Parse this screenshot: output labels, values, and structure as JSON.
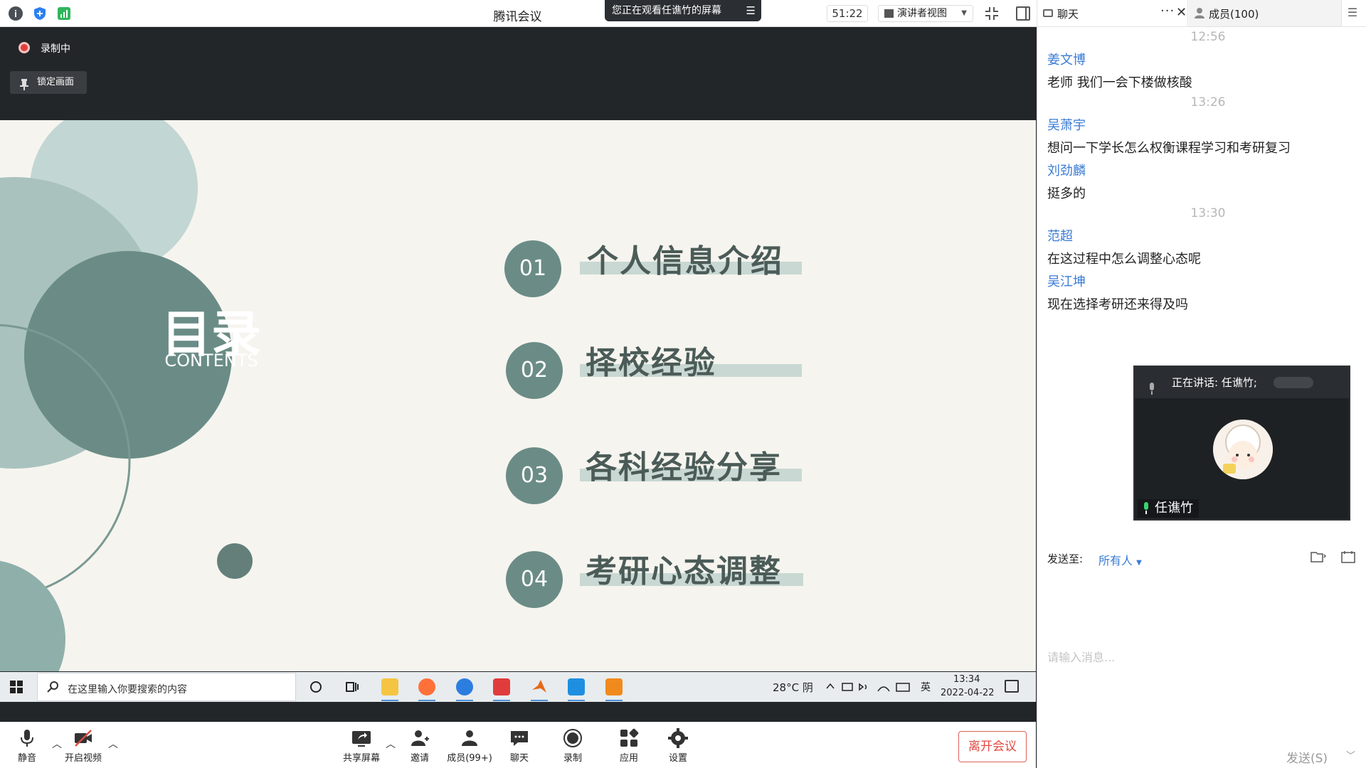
{
  "titlebar": {
    "app_title": "腾讯会议",
    "viewing_notice": "您正在观看任谯竹的屏幕",
    "timer": "51:22",
    "view_mode": "演讲者视图"
  },
  "tabs": {
    "chat": "聊天",
    "members": "成员(100)"
  },
  "stage": {
    "recording_label": "录制中",
    "lock_label": "锁定画面"
  },
  "slide": {
    "heading": "目录",
    "subheading": "CONTENTS",
    "items": [
      {
        "num": "01",
        "title": "个人信息介绍"
      },
      {
        "num": "02",
        "title": "择校经验"
      },
      {
        "num": "03",
        "title": "各科经验分享"
      },
      {
        "num": "04",
        "title": "考研心态调整"
      }
    ]
  },
  "taskbar": {
    "search_placeholder": "在这里输入你要搜索的内容",
    "weather": "28°C 阴",
    "lang": "英",
    "time": "13:34",
    "date": "2022-04-22"
  },
  "toolbar": {
    "mute": "静音",
    "video": "开启视频",
    "share": "共享屏幕",
    "invite": "邀请",
    "members": "成员(99+)",
    "chat": "聊天",
    "record": "录制",
    "apps": "应用",
    "settings": "设置",
    "leave": "离开会议"
  },
  "chat": {
    "messages": [
      {
        "type": "time",
        "text": "12:56"
      },
      {
        "type": "name",
        "text": "姜文博"
      },
      {
        "type": "msg",
        "text": "老师  我们一会下楼做核酸"
      },
      {
        "type": "time",
        "text": "13:26"
      },
      {
        "type": "name",
        "text": "吴萧宇"
      },
      {
        "type": "msg",
        "text": "想问一下学长怎么权衡课程学习和考研复习"
      },
      {
        "type": "name",
        "text": "刘劲麟"
      },
      {
        "type": "msg",
        "text": "挺多的"
      },
      {
        "type": "time",
        "text": "13:30"
      },
      {
        "type": "name",
        "text": "范超"
      },
      {
        "type": "msg",
        "text": "在这过程中怎么调整心态呢"
      },
      {
        "type": "name",
        "text": "吴江坤"
      },
      {
        "type": "msg",
        "text": "现在选择考研还来得及吗"
      }
    ],
    "speaking_label": "正在讲话: 任谯竹;",
    "speaker_name": "任谯竹",
    "send_to_label": "发送至:",
    "send_to_value": "所有人",
    "input_placeholder": "请输入消息...",
    "send_label": "发送(S)"
  }
}
